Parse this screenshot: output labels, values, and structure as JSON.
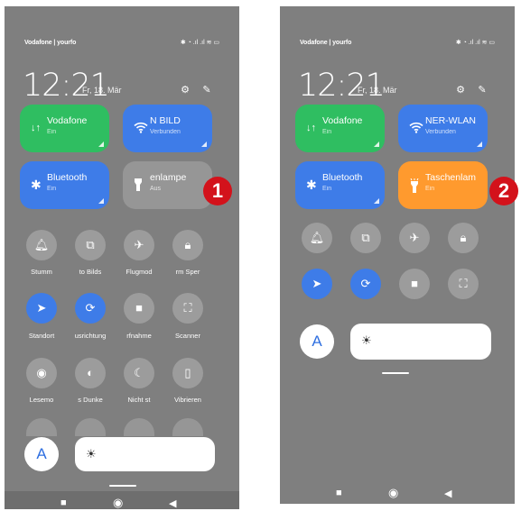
{
  "panel1": {
    "carrier": "Vodafone | yourfo",
    "status_icons": "✱ ◔ .ıl .ıl ≋ ▭",
    "time": "12:21",
    "date": "Fr, 18. Mär",
    "tiles": {
      "mobile": {
        "label": "Vodafone",
        "sub": "Ein",
        "icon": "↓↑"
      },
      "wifi": {
        "label": "N      BILD",
        "sub": "Verbunden",
        "icon": "wifi-icon"
      },
      "bluetooth": {
        "label": "Bluetooth",
        "sub": "Ein",
        "icon": "bluetooth-icon"
      },
      "flashlight": {
        "label": "enlampe",
        "sub": "Aus",
        "icon": "flashlight-icon"
      }
    },
    "row1_labels": [
      "Stumm",
      "to  Bilds",
      "Flugmod",
      "rm   Sper"
    ],
    "row2_labels": [
      "Standort",
      "usrichtung",
      "rfnahme",
      "Scanner"
    ],
    "row3_labels": [
      "Lesemo",
      "s   Dunke",
      "Nicht st",
      "Vibrieren"
    ],
    "auto_label": "A",
    "badge": "1"
  },
  "panel2": {
    "carrier": "Vodafone | yourfo",
    "status_icons": "✱ ◔ .ıl .ıl ≋ ▭",
    "time": "12:21",
    "date": "Fr, 18. Mär",
    "tiles": {
      "mobile": {
        "label": "Vodafone",
        "sub": "Ein",
        "icon": "↓↑"
      },
      "wifi": {
        "label": "NER-WLAN",
        "sub": "Verbunden",
        "icon": "wifi-icon"
      },
      "bluetooth": {
        "label": "Bluetooth",
        "sub": "Ein",
        "icon": "bluetooth-icon"
      },
      "flashlight": {
        "label": "Taschenlam",
        "sub": "Ein",
        "icon": "flashlight-icon"
      }
    },
    "auto_label": "A",
    "badge": "2"
  },
  "colors": {
    "panel_bg": "#7f7f7f",
    "green": "#2fbe61",
    "blue": "#3e7ce8",
    "orange": "#ff9a2e",
    "badge_red": "#d3121b"
  }
}
